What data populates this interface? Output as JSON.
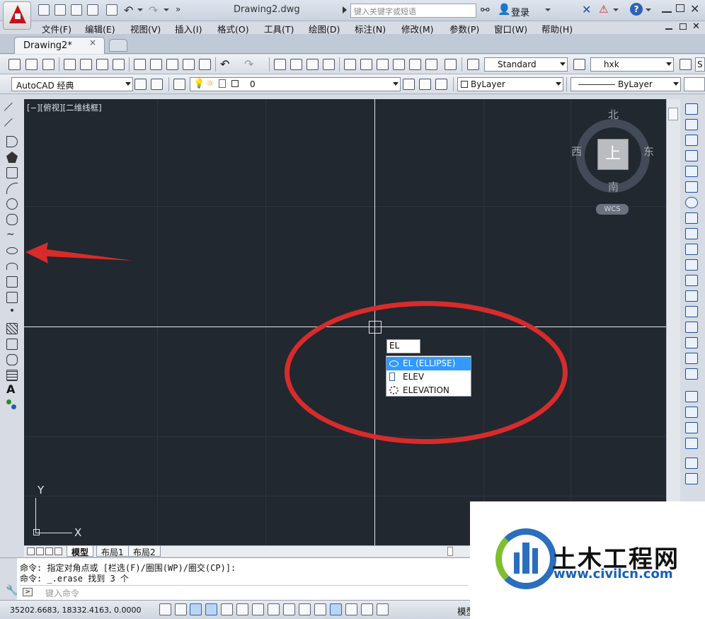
{
  "app": {
    "name": "AutoCAD",
    "document_title": "Drawing2.dwg"
  },
  "search": {
    "placeholder": "键入关键字或短语"
  },
  "account": {
    "login_label": "登录"
  },
  "menu": [
    "文件(F)",
    "编辑(E)",
    "视图(V)",
    "插入(I)",
    "格式(O)",
    "工具(T)",
    "绘图(D)",
    "标注(N)",
    "修改(M)",
    "参数(P)",
    "窗口(W)",
    "帮助(H)"
  ],
  "tabs": {
    "active_doc": "Drawing2*",
    "close_symbol": "×"
  },
  "toolbar_standard": {
    "text_style": "Standard",
    "dim_style": "hxk",
    "extra_style_fragment": "S"
  },
  "toolbar_layers": {
    "workspace": "AutoCAD 经典",
    "current_layer": "0",
    "color": "ByLayer",
    "linetype": "ByLayer"
  },
  "viewport": {
    "label": "[−][俯视][二维线框]"
  },
  "viewcube": {
    "north": "北",
    "south": "南",
    "west": "西",
    "east": "东",
    "face": "上",
    "wcs": "WCS"
  },
  "ucs": {
    "x": "X",
    "y": "Y"
  },
  "command_input": {
    "typed": "EL"
  },
  "autocomplete": {
    "items": [
      {
        "label": "EL (ELLIPSE)",
        "icon": "ellipse-icon",
        "selected": true
      },
      {
        "label": "ELEV",
        "icon": "elev-icon",
        "selected": false
      },
      {
        "label": "ELEVATION",
        "icon": "gear-icon",
        "selected": false
      }
    ]
  },
  "layout_tabs": [
    {
      "label": "模型",
      "active": true
    },
    {
      "label": "布局1",
      "active": false
    },
    {
      "label": "布局2",
      "active": false
    }
  ],
  "command_history": [
    "命令: 指定对角点或 [栏选(F)/圈围(WP)/圈交(CP)]:",
    "命令: _.erase 找到 3 个"
  ],
  "command_prompt": {
    "placeholder": "键入命令"
  },
  "status": {
    "coordinates": "35202.6683, 18332.4163, 0.0000",
    "model_label": "模型"
  },
  "watermark": {
    "title": "土木工程网",
    "url": "www.civilcn.com"
  },
  "colors": {
    "annotation_red": "#d82b2b",
    "selection_blue": "#3399ff",
    "canvas_bg": "#212830"
  }
}
